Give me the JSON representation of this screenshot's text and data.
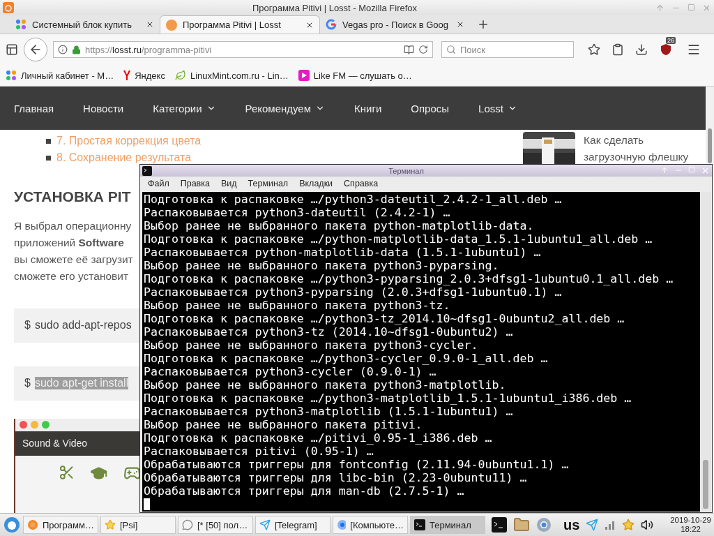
{
  "window": {
    "title": "Программа Pitivi | Losst - Mozilla Firefox"
  },
  "tabs": [
    {
      "label": "Системный блок купить",
      "kind": "dots",
      "selected": false
    },
    {
      "label": "Программа Pitivi | Losst",
      "kind": "losst",
      "selected": true
    },
    {
      "label": "Vegas pro - Поиск в Goog",
      "kind": "google",
      "selected": false
    }
  ],
  "address_bar": {
    "scheme": "https://",
    "host": "losst.ru",
    "path": "/programma-pitivi"
  },
  "search": {
    "placeholder": "Поиск"
  },
  "extension_badge": "26",
  "bookmarks": [
    {
      "label": "Личный кабинет - М…",
      "kind": "dots"
    },
    {
      "label": "Яндекс",
      "kind": "yandex"
    },
    {
      "label": "LinuxMint.com.ru - Lin…",
      "kind": "mint"
    },
    {
      "label": "Like FM — слушать о…",
      "kind": "play"
    }
  ],
  "site_nav": [
    {
      "label": "Главная",
      "dropdown": false
    },
    {
      "label": "Новости",
      "dropdown": false
    },
    {
      "label": "Категории",
      "dropdown": true
    },
    {
      "label": "Рекомендуем",
      "dropdown": true
    },
    {
      "label": "Книги",
      "dropdown": false
    },
    {
      "label": "Опросы",
      "dropdown": false
    },
    {
      "label": "Losst",
      "dropdown": true
    }
  ],
  "toc": [
    "7. Простая коррекция цвета",
    "8. Сохранение результата"
  ],
  "heading": "УСТАНОВКА PIT",
  "paragraph_lines": [
    "Я выбрал операционну",
    "приложений **Software**",
    "вы сможете её загрузит",
    "сможете его установит"
  ],
  "code_blocks": [
    {
      "prompt": "$",
      "text": "sudo add-apt-repos",
      "selected": false
    },
    {
      "prompt": "$",
      "text": "sudo apt-get install",
      "selected": true
    }
  ],
  "app_screenshot": {
    "title": "Sound & Video"
  },
  "sidebar_post": {
    "title_lines": [
      "Как сделать",
      "загрузочную флешку"
    ]
  },
  "terminal": {
    "title": "Терминал",
    "menu": [
      "Файл",
      "Правка",
      "Вид",
      "Терминал",
      "Вкладки",
      "Справка"
    ],
    "lines": [
      "Подготовка к распаковке …/python3-dateutil_2.4.2-1_all.deb …",
      "Распаковывается python3-dateutil (2.4.2-1) …",
      "Выбор ранее не выбранного пакета python-matplotlib-data.",
      "Подготовка к распаковке …/python-matplotlib-data_1.5.1-1ubuntu1_all.deb …",
      "Распаковывается python-matplotlib-data (1.5.1-1ubuntu1) …",
      "Выбор ранее не выбранного пакета python3-pyparsing.",
      "Подготовка к распаковке …/python3-pyparsing_2.0.3+dfsg1-1ubuntu0.1_all.deb …",
      "Распаковывается python3-pyparsing (2.0.3+dfsg1-1ubuntu0.1) …",
      "Выбор ранее не выбранного пакета python3-tz.",
      "Подготовка к распаковке …/python3-tz_2014.10~dfsg1-0ubuntu2_all.deb …",
      "Распаковывается python3-tz (2014.10~dfsg1-0ubuntu2) …",
      "Выбор ранее не выбранного пакета python3-cycler.",
      "Подготовка к распаковке …/python3-cycler_0.9.0-1_all.deb …",
      "Распаковывается python3-cycler (0.9.0-1) …",
      "Выбор ранее не выбранного пакета python3-matplotlib.",
      "Подготовка к распаковке …/python3-matplotlib_1.5.1-1ubuntu1_i386.deb …",
      "Распаковывается python3-matplotlib (1.5.1-1ubuntu1) …",
      "Выбор ранее не выбранного пакета pitivi.",
      "Подготовка к распаковке …/pitivi_0.95-1_i386.deb …",
      "Распаковывается pitivi (0.95-1) …",
      "Обрабатываются триггеры для fontconfig (2.11.94-0ubuntu1.1) …",
      "Обрабатываются триггеры для libc-bin (2.23-0ubuntu11) …",
      "Обрабатываются триггеры для man-db (2.7.5-1) …"
    ]
  },
  "taskbar": {
    "tasks": [
      {
        "label": "Программ…",
        "kind": "firefox",
        "selected": false
      },
      {
        "label": "[Psi]",
        "kind": "star",
        "selected": false
      },
      {
        "label": "[* [50] пол…",
        "kind": "bubble",
        "selected": false
      },
      {
        "label": "[Telegram]",
        "kind": "telegram",
        "selected": false
      },
      {
        "label": "[Компьюте…",
        "kind": "chromium",
        "selected": false
      },
      {
        "label": "Терминал",
        "kind": "terminal",
        "selected": true
      }
    ],
    "keyboard_layout": "us",
    "date": "2019-10-29",
    "time": "18:22"
  }
}
